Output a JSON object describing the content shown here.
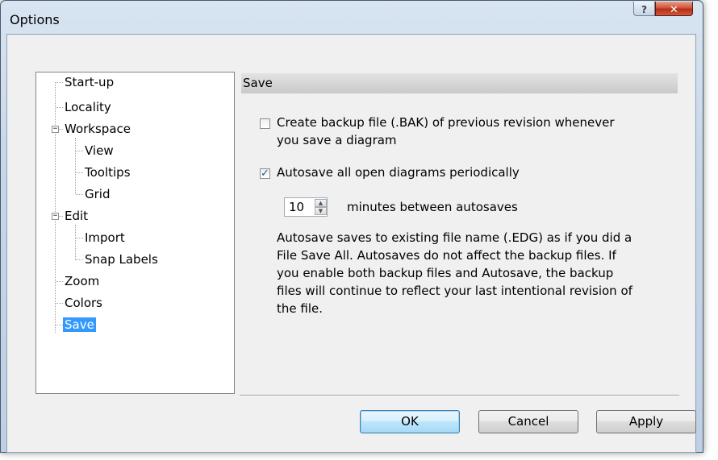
{
  "window": {
    "title": "Options",
    "help_glyph": "?",
    "close_glyph": "✕"
  },
  "tree": {
    "items": [
      {
        "label": "Start-up"
      },
      {
        "label": "Locality"
      },
      {
        "label": "Workspace",
        "expanded": true
      },
      {
        "label": "View"
      },
      {
        "label": "Tooltips"
      },
      {
        "label": "Grid"
      },
      {
        "label": "Edit",
        "expanded": true
      },
      {
        "label": "Import"
      },
      {
        "label": "Snap Labels"
      },
      {
        "label": "Zoom"
      },
      {
        "label": "Colors"
      },
      {
        "label": "Save",
        "selected": true
      }
    ]
  },
  "panel": {
    "header": "Save",
    "backup": {
      "checked": false,
      "line1": "Create backup file (.BAK) of previous revision whenever",
      "line2": "you save a diagram"
    },
    "autosave": {
      "checked": true,
      "label": "Autosave all open diagrams periodically"
    },
    "interval": {
      "value": "10",
      "label": "minutes between autosaves"
    },
    "description": [
      "Autosave saves to existing file name (.EDG) as if you did a",
      "File Save All.  Autosaves do not affect the backup files.  If",
      "you enable both backup files and Autosave, the backup",
      "files will continue to reflect your last intentional revision of",
      "the file."
    ]
  },
  "buttons": {
    "ok": "OK",
    "cancel": "Cancel",
    "apply": "Apply"
  }
}
